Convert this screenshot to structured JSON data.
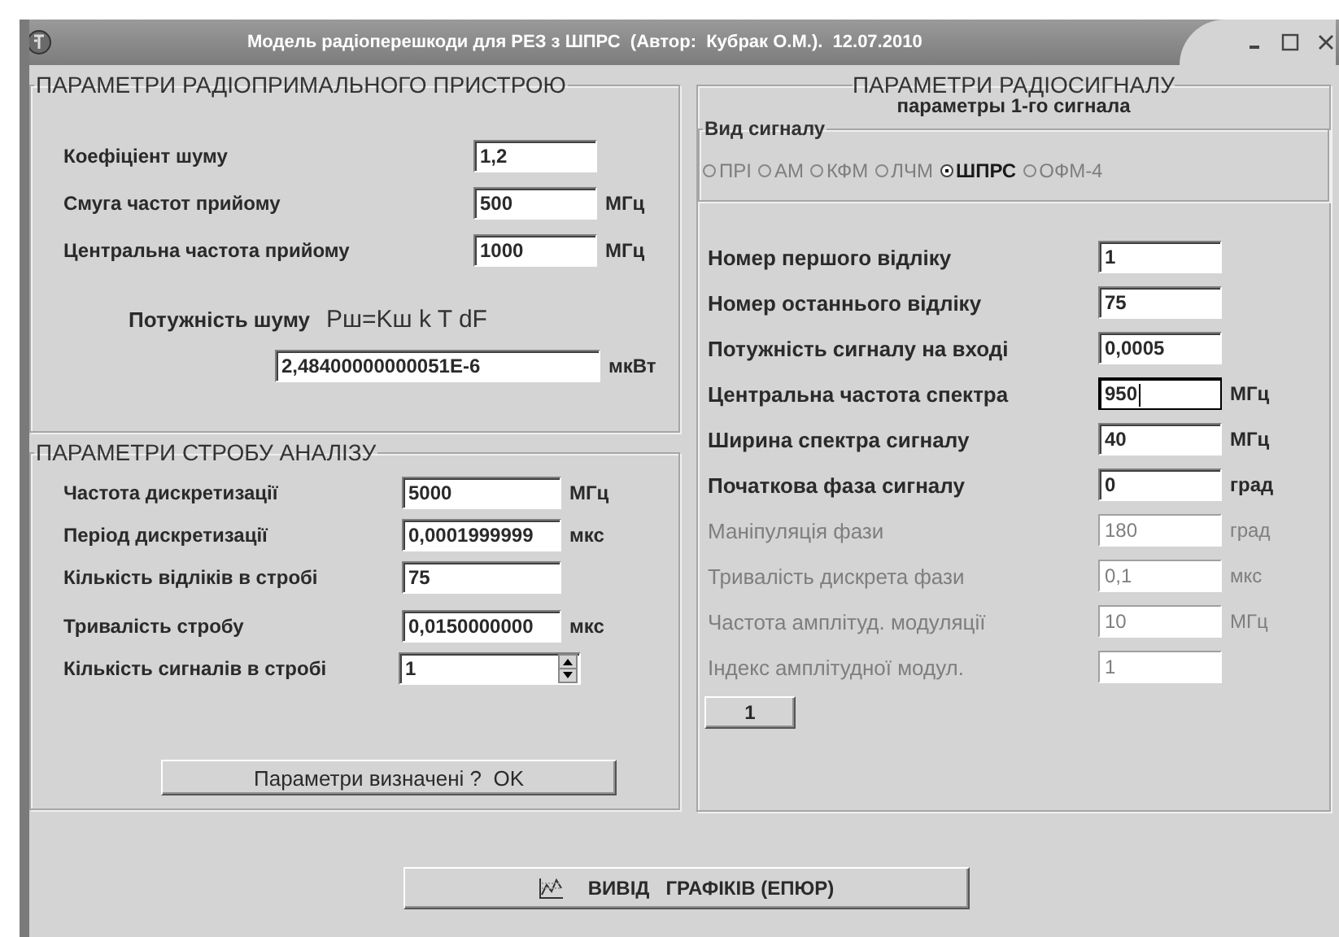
{
  "window": {
    "title": "Модель радіоперешкоди для РЕЗ з ШПРС  (Автор:  Кубрак О.М.).  12.07.2010"
  },
  "receiver": {
    "title": "ПАРАМЕТРИ РАДІОПРИМАЛЬНОГО ПРИСТРОЮ",
    "fields": [
      {
        "label": "Коефіціент шуму",
        "value": "1,2"
      },
      {
        "label": "Смуга частот прийому",
        "value": "500",
        "unit": "МГц"
      },
      {
        "label": "Центральна частота прийому",
        "value": "1000",
        "unit": "МГц"
      }
    ],
    "noise_power": {
      "label": "Потужність шуму",
      "formula": "Pш=Kш k T dF",
      "value": "2,48400000000051E-6",
      "unit": "мкВт"
    }
  },
  "gate": {
    "title": "ПАРАМЕТРИ СТРОБУ АНАЛІЗУ",
    "fields": [
      {
        "kind": "text",
        "label": "Частота дискретизації",
        "value": "5000",
        "unit": "МГц"
      },
      {
        "kind": "text",
        "label": "Період дискретизації",
        "value": "0,0001999999",
        "unit": "мкс"
      },
      {
        "kind": "text",
        "label": "Кількість відліків в стробі",
        "value": "75"
      },
      {
        "kind": "text",
        "label": "Тривалість стробу",
        "value": "0,0150000000",
        "unit": "мкс"
      },
      {
        "kind": "spinner",
        "label": "Кількість сигналів в стробі",
        "value": "1"
      }
    ],
    "button": "Параметри визначені ?  OK"
  },
  "signal": {
    "title": "ПАРАМЕТРИ РАДІОСИГНАЛУ",
    "subtitle": "параметры 1-го сигнала",
    "signal_type": {
      "title": "Вид сигналу",
      "options": [
        {
          "label": "ПРІ",
          "selected": false,
          "disabled": true
        },
        {
          "label": "АМ",
          "selected": false,
          "disabled": true
        },
        {
          "label": "КФМ",
          "selected": false,
          "disabled": true
        },
        {
          "label": "ЛЧМ",
          "selected": false,
          "disabled": true
        },
        {
          "label": "ШПРС",
          "selected": true,
          "disabled": false
        },
        {
          "label": "ОФМ-4",
          "selected": false,
          "disabled": true
        }
      ]
    },
    "fields": [
      {
        "label": "Номер першого відліку",
        "value": "1",
        "disabled": false,
        "focused": false
      },
      {
        "label": "Номер останнього відліку",
        "value": "75",
        "disabled": false,
        "focused": false
      },
      {
        "label": "Потужність сигналу на вході",
        "value": "0,0005",
        "disabled": false,
        "focused": false
      },
      {
        "label": "Центральна частота спектра",
        "value": "950",
        "unit": "МГц",
        "disabled": false,
        "focused": true
      },
      {
        "label": "Ширина спектра сигналу",
        "value": "40",
        "unit": "МГц",
        "disabled": false,
        "focused": false
      },
      {
        "label": "Початкова фаза сигналу",
        "value": "0",
        "unit": "град",
        "disabled": false,
        "focused": false
      },
      {
        "label": "Маніпуляція фази",
        "value": "180",
        "unit": "град",
        "disabled": true,
        "focused": false
      },
      {
        "label": "Тривалість  дискрета фази",
        "value": "0,1",
        "unit": "мкс",
        "disabled": true,
        "focused": false
      },
      {
        "label": "Частота амплітуд. модуляції",
        "value": "10",
        "unit": "МГц",
        "disabled": true,
        "focused": false
      },
      {
        "label": "Індекс амплітудної модул.",
        "value": "1",
        "disabled": true,
        "focused": false
      }
    ],
    "button": "1"
  },
  "output_button": {
    "label": "ВИВІД   ГРАФІКІВ (ЕПЮР)"
  }
}
